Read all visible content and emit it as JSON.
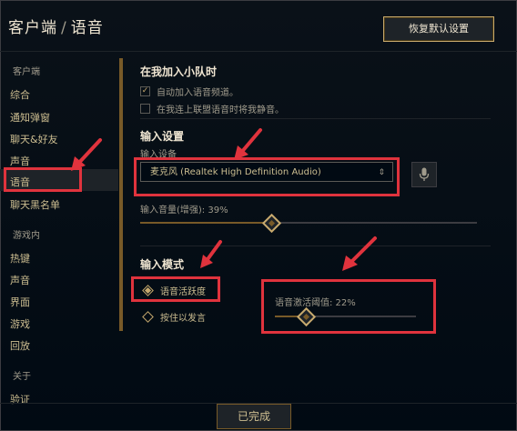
{
  "header": {
    "breadcrumb_parent": "客户端",
    "separator": "/",
    "breadcrumb_current": "语音",
    "restore_defaults_label": "恢复默认设置"
  },
  "sidebar": {
    "section_client": "客户端",
    "client_items": [
      "综合",
      "通知弹窗",
      "聊天&好友",
      "声音",
      "语音",
      "聊天黑名单"
    ],
    "section_ingame": "游戏内",
    "ingame_items": [
      "热键",
      "声音",
      "界面",
      "游戏",
      "回放"
    ],
    "section_about": "关于",
    "about_items": [
      "验证"
    ],
    "active_item": "语音"
  },
  "party": {
    "title": "在我加入小队时",
    "auto_join_label": "自动加入语音频道。",
    "auto_join_checked": true,
    "mute_label": "在我连上联盟语音时将我静音。",
    "mute_checked": false
  },
  "input_settings": {
    "title": "输入设置",
    "device_label": "输入设备",
    "device_value": "麦克风 (Realtek High Definition Audio)",
    "volume_label": "输入音量(增强): 39%",
    "volume_value": 0.39
  },
  "input_mode": {
    "title": "输入模式",
    "voice_activity_label": "语音活跃度",
    "push_to_talk_label": "按住以发言",
    "selected": "voice_activity",
    "threshold_label": "语音激活阈值: 22%",
    "threshold_value": 0.22
  },
  "footer": {
    "done_label": "已完成"
  },
  "colors": {
    "background": "#010a13",
    "gold": "#c8aa6e",
    "annotation_red": "#e0333d"
  }
}
